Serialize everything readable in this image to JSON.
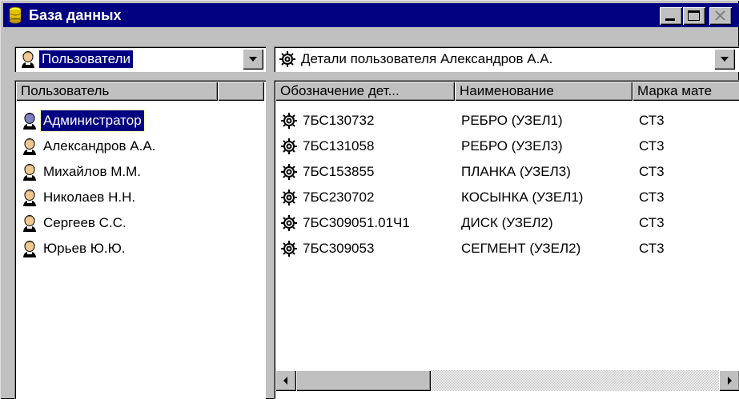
{
  "window": {
    "title": "База данных",
    "icons": {
      "app": "database-icon",
      "minimize": "minimize-icon",
      "maximize": "maximize-icon",
      "close": "close-icon"
    }
  },
  "left_panel": {
    "combo": {
      "value": "Пользователи",
      "icon": "user-icon"
    },
    "header": "Пользователь",
    "users": [
      {
        "name": "Администратор",
        "icon": "admin-user-icon",
        "selected": true
      },
      {
        "name": "Александров А.А.",
        "icon": "user-icon"
      },
      {
        "name": "Михайлов М.М.",
        "icon": "user-icon"
      },
      {
        "name": "Николаев Н.Н.",
        "icon": "user-icon"
      },
      {
        "name": "Сергеев С.С.",
        "icon": "user-icon"
      },
      {
        "name": "Юрьев Ю.Ю.",
        "icon": "user-icon"
      }
    ]
  },
  "right_panel": {
    "combo": {
      "value": "Детали пользователя Александров А.А.",
      "icon": "gear-icon"
    },
    "columns": [
      "Обозначение дет...",
      "Наименование",
      "Марка мате"
    ],
    "rows": [
      {
        "designation": "7БС130732",
        "name": "РЕБРО (УЗЕЛ1)",
        "material": "СТ3",
        "icon": "gear-icon"
      },
      {
        "designation": "7БС131058",
        "name": "РЕБРО (УЗЕЛ3)",
        "material": "СТ3",
        "icon": "gear-icon"
      },
      {
        "designation": "7БС153855",
        "name": "ПЛАНКА (УЗЕЛ3)",
        "material": "СТ3",
        "icon": "gear-icon"
      },
      {
        "designation": "7БС230702",
        "name": "КОСЫНКА (УЗЕЛ1)",
        "material": "СТ3",
        "icon": "gear-icon"
      },
      {
        "designation": "7БС309051.01Ч1",
        "name": "ДИСК (УЗЕЛ2)",
        "material": "СТ3",
        "icon": "gear-icon"
      },
      {
        "designation": "7БС309053",
        "name": "СЕГМЕНТ (УЗЕЛ2)",
        "material": "СТ3",
        "icon": "gear-icon"
      }
    ]
  },
  "colors": {
    "titlebar": "#000080",
    "selection": "#000080",
    "face": "#c0c0c0"
  }
}
